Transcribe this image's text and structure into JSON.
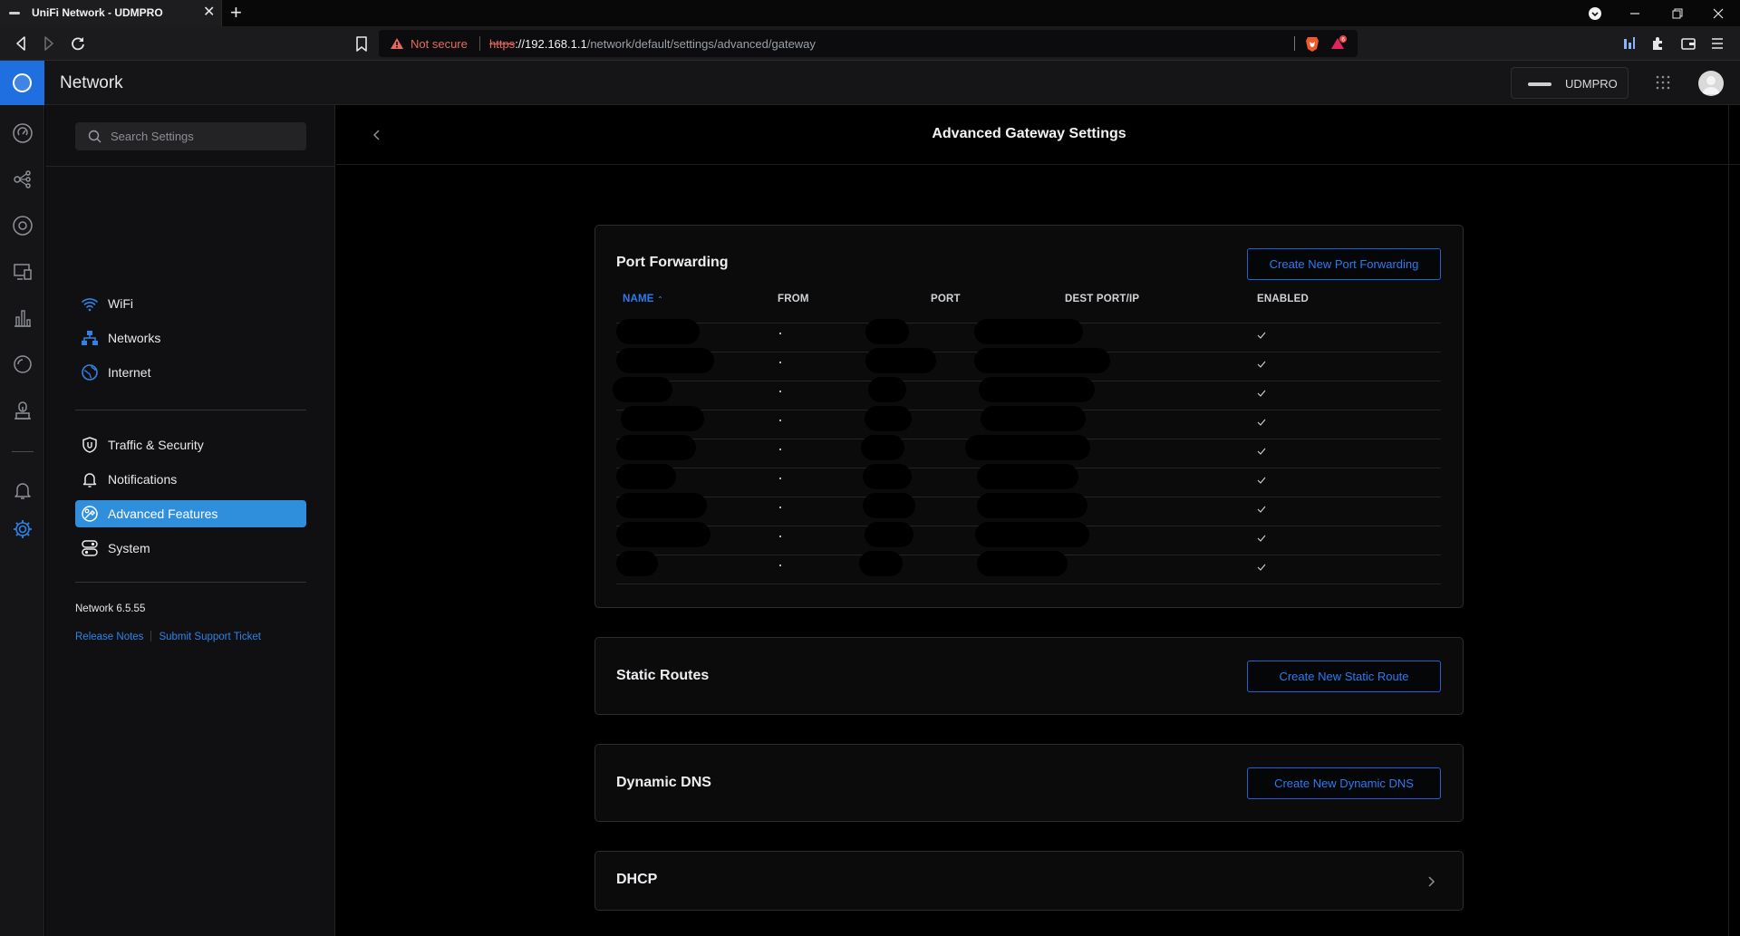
{
  "browser": {
    "tab_title": "UniFi Network - UDMPRO",
    "security_label": "Not secure",
    "url_scheme": "https",
    "url_host": "://192.168.1.1",
    "url_path": "/network/default/settings/advanced/gateway"
  },
  "app": {
    "title": "Network",
    "device_name": "UDMPRO",
    "accent_color": "#2f8fdc",
    "link_color": "#2b7bf0"
  },
  "rail": {
    "icons": [
      "dashboard-icon",
      "topology-icon",
      "devices-icon",
      "clients-icon",
      "statistics-icon",
      "insights-icon",
      "security-icon",
      "alerts-icon",
      "settings-icon"
    ]
  },
  "sidebar": {
    "search_placeholder": "Search Settings",
    "primary_items": [
      {
        "label": "WiFi",
        "icon": "wifi-icon"
      },
      {
        "label": "Networks",
        "icon": "networks-icon"
      },
      {
        "label": "Internet",
        "icon": "internet-icon"
      }
    ],
    "secondary_items": [
      {
        "label": "Traffic & Security",
        "icon": "shield-icon"
      },
      {
        "label": "Notifications",
        "icon": "bell-icon"
      },
      {
        "label": "Advanced Features",
        "icon": "advanced-icon",
        "active": true
      },
      {
        "label": "System",
        "icon": "system-icon"
      }
    ],
    "version": "Network 6.5.55",
    "release_notes": "Release Notes",
    "support_ticket": "Submit Support Ticket"
  },
  "main": {
    "page_title": "Advanced Gateway Settings",
    "port_forwarding": {
      "title": "Port Forwarding",
      "button": "Create New Port Forwarding",
      "columns": {
        "name": "NAME",
        "from": "FROM",
        "port": "PORT",
        "dest": "DEST PORT/IP",
        "enabled": "ENABLED"
      },
      "rows": [
        {
          "from": "*",
          "enabled": true
        },
        {
          "from": "*",
          "enabled": true
        },
        {
          "from": "*",
          "enabled": true
        },
        {
          "from": "*",
          "enabled": true
        },
        {
          "from": "*",
          "enabled": true
        },
        {
          "from": "*",
          "enabled": true
        },
        {
          "from": "*",
          "enabled": true
        },
        {
          "from": "*",
          "enabled": true
        },
        {
          "from": "*",
          "enabled": true
        }
      ]
    },
    "static_routes": {
      "title": "Static Routes",
      "button": "Create New Static Route"
    },
    "dynamic_dns": {
      "title": "Dynamic DNS",
      "button": "Create New Dynamic DNS"
    },
    "dhcp": {
      "title": "DHCP"
    }
  }
}
